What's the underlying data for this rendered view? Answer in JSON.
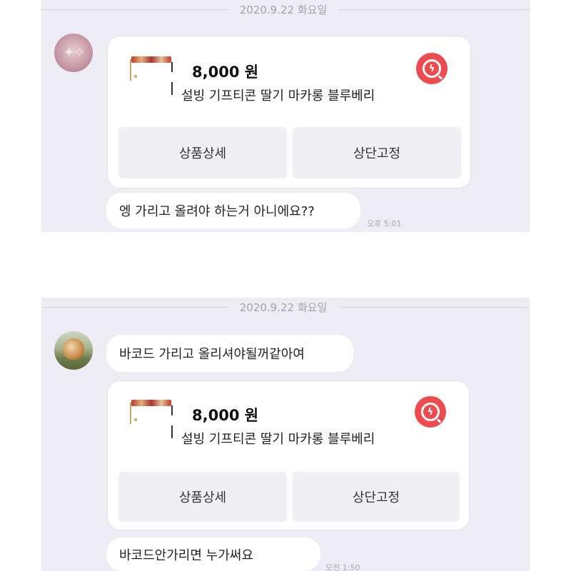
{
  "screenshots": [
    {
      "date": "2020.9.22 화요일",
      "card": {
        "price": "8,000 원",
        "product_name": "설빙 기프티콘 딸기 마카롱 블루베리",
        "detail_button": "상품상세",
        "pin_button": "상단고정"
      },
      "message": "엥 가리고 올려야 하는거 아니에요??",
      "time": "오후 5:01"
    },
    {
      "date": "2020.9.22 화요일",
      "message_top": "바코드 가리고 올리셔야될꺼같아여",
      "card": {
        "price": "8,000 원",
        "product_name": "설빙 기프티콘 딸기 마카롱 블루베리",
        "detail_button": "상품상세",
        "pin_button": "상단고정"
      },
      "message": "바코드안가리면 누가써요",
      "time": "오전 1:50"
    }
  ],
  "colors": {
    "panel_bg": "#eeedf5",
    "badge": "#ee4b4f",
    "button_bg": "#f0eff4"
  },
  "icons": {
    "badge": "lightning-search-icon"
  }
}
